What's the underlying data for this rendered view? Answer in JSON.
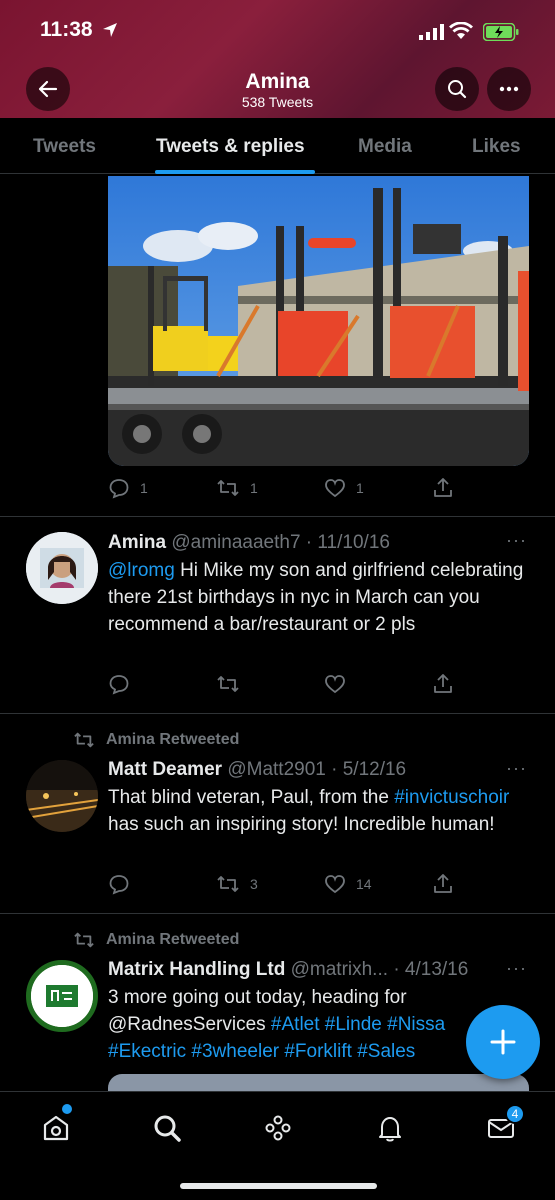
{
  "status_bar": {
    "time": "11:38"
  },
  "profile": {
    "name": "Amina",
    "tweet_count": "538 Tweets"
  },
  "tabs": [
    {
      "label": "Tweets"
    },
    {
      "label": "Tweets & replies"
    },
    {
      "label": "Media"
    },
    {
      "label": "Likes"
    }
  ],
  "active_tab": "Tweets & replies",
  "top_tweet": {
    "reply_count": "1",
    "retweet_count": "1",
    "like_count": "1"
  },
  "tweets": [
    {
      "name": "Amina",
      "handle": "@aminaaaeth7",
      "date": "· 11/10/16",
      "mention": "@lromg",
      "text": "Hi Mike my son and girlfriend celebrating there 21st birthdays in nyc in March can you recommend a bar/restaurant or 2 pls",
      "more": "···"
    },
    {
      "retweeted_by": "Amina Retweeted",
      "name": "Matt Deamer",
      "handle": "@Matt2901",
      "date": "· 5/12/16",
      "text_before": "That blind veteran, Paul, from the",
      "hashtag": "#invictuschoir",
      "text_after": "has such an inspiring story! Incredible human!",
      "retweet_count": "3",
      "like_count": "14",
      "more": "···"
    },
    {
      "retweeted_by": "Amina Retweeted",
      "name": "Matrix Handling Ltd",
      "handle": "@matrixh...",
      "date": "· 4/13/16",
      "text_before": "3 more going out today, heading for @RadnesServices",
      "hashtags_line1": "#Atlet #Linde #Nissa",
      "hashtags_line2": "#Ekectric #3wheeler #Forklift #Sales",
      "more": "···"
    }
  ],
  "tab_bar": {
    "messages_badge": "4"
  },
  "colors": {
    "accent": "#1d9bf0",
    "header": "#7a1430",
    "muted": "#71767b"
  },
  "icons": [
    "back-arrow-icon",
    "search-icon",
    "more-icon",
    "reply-icon",
    "retweet-icon",
    "like-icon",
    "share-icon",
    "compose-plus-icon",
    "home-icon",
    "explore-icon",
    "spaces-icon",
    "notifications-icon",
    "messages-icon"
  ]
}
